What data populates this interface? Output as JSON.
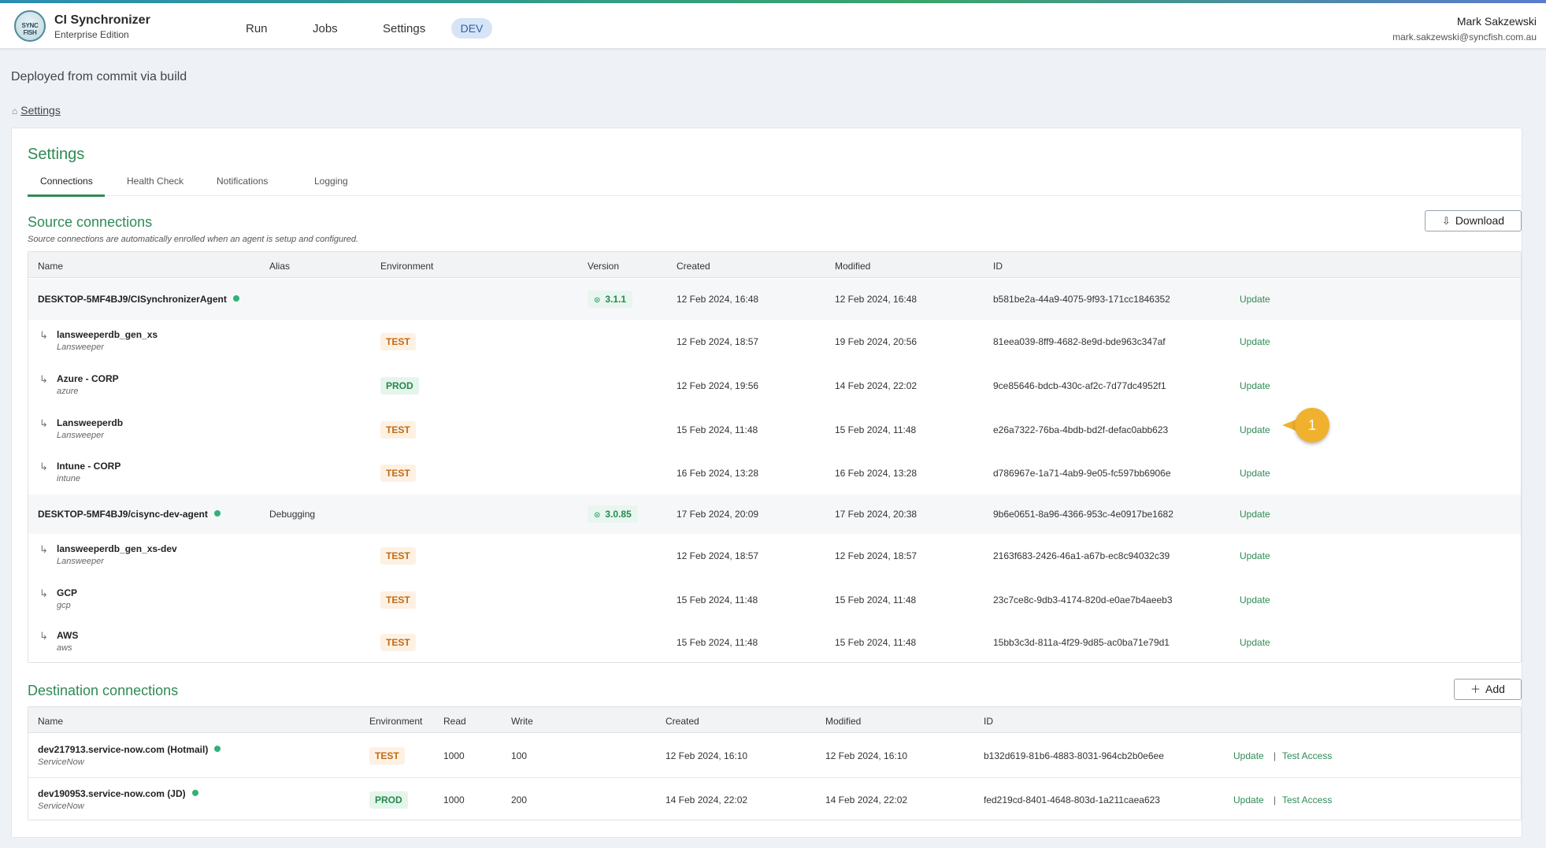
{
  "header": {
    "logo_text": "SYNC FISH",
    "app_title": "CI Synchronizer",
    "app_subtitle": "Enterprise Edition",
    "nav": [
      "Run",
      "Jobs",
      "Settings"
    ],
    "env_badge": "DEV",
    "user_name": "Mark Sakzewski",
    "user_email": "mark.sakzewski@syncfish.com.au"
  },
  "deployed_text": "Deployed from commit via build",
  "breadcrumb": {
    "label": "Settings"
  },
  "page": {
    "title": "Settings",
    "tabs": [
      "Connections",
      "Health Check",
      "Notifications",
      "Logging"
    ]
  },
  "source": {
    "title": "Source connections",
    "note": "Source connections are automatically enrolled when an agent is setup and configured.",
    "download_label": "Download",
    "columns": [
      "Name",
      "Alias",
      "Environment",
      "Version",
      "Created",
      "Modified",
      "ID"
    ],
    "action_label": "Update",
    "rows": [
      {
        "kind": "agent",
        "name": "DESKTOP-5MF4BJ9/CISynchronizerAgent",
        "alias": "",
        "version": "3.1.1",
        "created": "12 Feb 2024, 16:48",
        "modified": "12 Feb 2024, 16:48",
        "id": "b581be2a-44a9-4075-9f93-171cc1846352"
      },
      {
        "kind": "conn",
        "name": "lansweeperdb_gen_xs",
        "sub": "Lansweeper",
        "env": "TEST",
        "created": "12 Feb 2024, 18:57",
        "modified": "19 Feb 2024, 20:56",
        "id": "81eea039-8ff9-4682-8e9d-bde963c347af"
      },
      {
        "kind": "conn",
        "name": "Azure - CORP",
        "sub": "azure",
        "env": "PROD",
        "created": "12 Feb 2024, 19:56",
        "modified": "14 Feb 2024, 22:02",
        "id": "9ce85646-bdcb-430c-af2c-7d77dc4952f1"
      },
      {
        "kind": "conn",
        "name": "Lansweeperdb",
        "sub": "Lansweeper",
        "env": "TEST",
        "created": "15 Feb 2024, 11:48",
        "modified": "15 Feb 2024, 11:48",
        "id": "e26a7322-76ba-4bdb-bd2f-defac0abb623"
      },
      {
        "kind": "conn",
        "name": "Intune - CORP",
        "sub": "intune",
        "env": "TEST",
        "created": "16 Feb 2024, 13:28",
        "modified": "16 Feb 2024, 13:28",
        "id": "d786967e-1a71-4ab9-9e05-fc597bb6906e"
      },
      {
        "kind": "agent",
        "name": "DESKTOP-5MF4BJ9/cisync-dev-agent",
        "alias": "Debugging",
        "version": "3.0.85",
        "created": "17 Feb 2024, 20:09",
        "modified": "17 Feb 2024, 20:38",
        "id": "9b6e0651-8a96-4366-953c-4e0917be1682"
      },
      {
        "kind": "conn",
        "name": "lansweeperdb_gen_xs-dev",
        "sub": "Lansweeper",
        "env": "TEST",
        "created": "12 Feb 2024, 18:57",
        "modified": "12 Feb 2024, 18:57",
        "id": "2163f683-2426-46a1-a67b-ec8c94032c39"
      },
      {
        "kind": "conn",
        "name": "GCP",
        "sub": "gcp",
        "env": "TEST",
        "created": "15 Feb 2024, 11:48",
        "modified": "15 Feb 2024, 11:48",
        "id": "23c7ce8c-9db3-4174-820d-e0ae7b4aeeb3"
      },
      {
        "kind": "conn",
        "name": "AWS",
        "sub": "aws",
        "env": "TEST",
        "created": "15 Feb 2024, 11:48",
        "modified": "15 Feb 2024, 11:48",
        "id": "15bb3c3d-811a-4f29-9d85-ac0ba71e79d1"
      }
    ]
  },
  "destination": {
    "title": "Destination connections",
    "add_label": "Add",
    "columns": [
      "Name",
      "Environment",
      "Read",
      "Write",
      "Created",
      "Modified",
      "ID"
    ],
    "update_label": "Update",
    "test_label": "Test Access",
    "separator": "|",
    "rows": [
      {
        "name": "dev217913.service-now.com (Hotmail)",
        "sub": "ServiceNow",
        "env": "TEST",
        "read": "1000",
        "write": "100",
        "created": "12 Feb 2024, 16:10",
        "modified": "12 Feb 2024, 16:10",
        "id": "b132d619-81b6-4883-8031-964cb2b0e6ee"
      },
      {
        "name": "dev190953.service-now.com (JD)",
        "sub": "ServiceNow",
        "env": "PROD",
        "read": "1000",
        "write": "200",
        "created": "14 Feb 2024, 22:02",
        "modified": "14 Feb 2024, 22:02",
        "id": "fed219cd-8401-4648-803d-1a211caea623"
      }
    ]
  },
  "callout": {
    "label": "1"
  },
  "colors": {
    "accent": "#2f8a55",
    "test": "#c36a12",
    "prod": "#238a4d",
    "callout": "#f0b12e"
  },
  "icons": {
    "home": "home-icon",
    "download": "download-icon",
    "add": "plus-icon",
    "child": "child-arrow-icon",
    "version": "check-circle-icon",
    "status": "status-dot"
  }
}
